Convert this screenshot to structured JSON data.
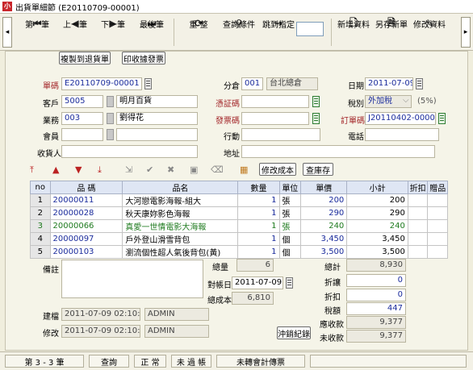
{
  "window": {
    "title": "出貨單細節 (E20110709-00001)",
    "app_icon": "小"
  },
  "toolbar": {
    "buttons": [
      {
        "icon": "first-record-icon",
        "glyph": "⏮",
        "label": "第一筆"
      },
      {
        "icon": "prev-record-icon",
        "glyph": "◀",
        "label": "上一筆"
      },
      {
        "icon": "next-record-icon",
        "glyph": "▶",
        "label": "下一筆"
      },
      {
        "icon": "last-record-icon",
        "glyph": "⏭",
        "label": "最後筆"
      },
      {
        "icon": "refresh-icon",
        "glyph": "⟳",
        "label": "重 整"
      },
      {
        "icon": "binoculars-icon",
        "glyph": "⚲",
        "label": "查詢條件"
      },
      {
        "icon": "jump-icon",
        "glyph": "↪",
        "label": "跳到指定"
      },
      {
        "icon": "new-document-icon",
        "glyph": "🗋",
        "label": "新增資料"
      },
      {
        "icon": "save-new-icon",
        "glyph": "🗎",
        "label": "另存新單"
      },
      {
        "icon": "edit-document-icon",
        "glyph": "✎",
        "label": "修改資料"
      }
    ],
    "jump_value": ""
  },
  "actions": {
    "copy_return": "複製到退貨單",
    "print_invoice": "印收據發票"
  },
  "form": {
    "order_no_label": "單碼",
    "order_no": "E20110709-00001",
    "warehouse_label": "分倉",
    "warehouse_code": "001",
    "warehouse_name": "台北總倉",
    "date_label": "日期",
    "date": "2011-07-09",
    "customer_label": "客戶",
    "customer_code": "5005",
    "customer_name": "明月百貨",
    "voucher_label": "憑証碼",
    "voucher": "",
    "tax_label": "稅別",
    "tax_type": "外加稅",
    "tax_rate": "(5%)",
    "sales_label": "業務",
    "sales_code": "003",
    "sales_name": "劉得花",
    "invoice_label": "發票碼",
    "invoice": "",
    "po_label": "訂單碼",
    "po": "J20110402-00001",
    "member_label": "會員",
    "member_code": "",
    "member_name": "",
    "mobile_label": "行動",
    "mobile": "",
    "phone_label": "電話",
    "phone": "",
    "receiver_label": "收貨人",
    "receiver": "",
    "address_label": "地址",
    "address": ""
  },
  "grid_toolbar": {
    "edit_cost": "修改成本",
    "check_stock": "查庫存"
  },
  "table": {
    "headers": [
      "no",
      "品 碼",
      "品名",
      "數量",
      "單位",
      "單價",
      "小計",
      "折扣",
      "贈品"
    ],
    "rows": [
      {
        "no": "1",
        "code": "20000011",
        "name": "大河戀電影海報-組大",
        "qty": "1",
        "unit": "張",
        "price": "200",
        "subtotal": "200",
        "discount": "",
        "gift": ""
      },
      {
        "no": "2",
        "code": "20000028",
        "name": "秋天康妳影色海報",
        "qty": "1",
        "unit": "張",
        "price": "290",
        "subtotal": "290",
        "discount": "",
        "gift": ""
      },
      {
        "no": "3",
        "code": "20000066",
        "name": "真愛一世情電影大海報",
        "qty": "1",
        "unit": "張",
        "price": "240",
        "subtotal": "240",
        "discount": "",
        "gift": ""
      },
      {
        "no": "4",
        "code": "20000097",
        "name": "戶外登山滑雪背包",
        "qty": "1",
        "unit": "個",
        "price": "3,450",
        "subtotal": "3,450",
        "discount": "",
        "gift": ""
      },
      {
        "no": "5",
        "code": "20000103",
        "name": "瀏流個性超人氣後背包(黃)",
        "qty": "1",
        "unit": "個",
        "price": "3,500",
        "subtotal": "3,500",
        "discount": "",
        "gift": ""
      }
    ]
  },
  "summary": {
    "memo_label": "備註",
    "memo": "",
    "total_qty_label": "總量",
    "total_qty": "6",
    "settle_date_label": "對帳日",
    "settle_date": "2011-07-09",
    "total_cost_label": "總成本",
    "total_cost": "6,810",
    "total_label": "總計",
    "total": "8,930",
    "discount_label": "折讓",
    "discount": "0",
    "rebate_label": "折扣",
    "rebate": "0",
    "tax_label": "稅額",
    "tax": "447",
    "receivable_label": "應收款",
    "receivable": "9,377",
    "unpaid_label": "未收款",
    "unpaid": "9,377",
    "offset_button": "沖銷紀錄"
  },
  "audit": {
    "created_label": "建檔",
    "created_at": "2011-07-09 02:10:19",
    "created_by": "ADMIN",
    "modified_label": "修改",
    "modified_at": "2011-07-09 02:10:19",
    "modified_by": "ADMIN"
  },
  "status": {
    "record": "第 3 - 3 筆",
    "mode": "查詢",
    "state": "正 常",
    "post": "未 過 帳",
    "accounting": "未轉會計傳票"
  }
}
